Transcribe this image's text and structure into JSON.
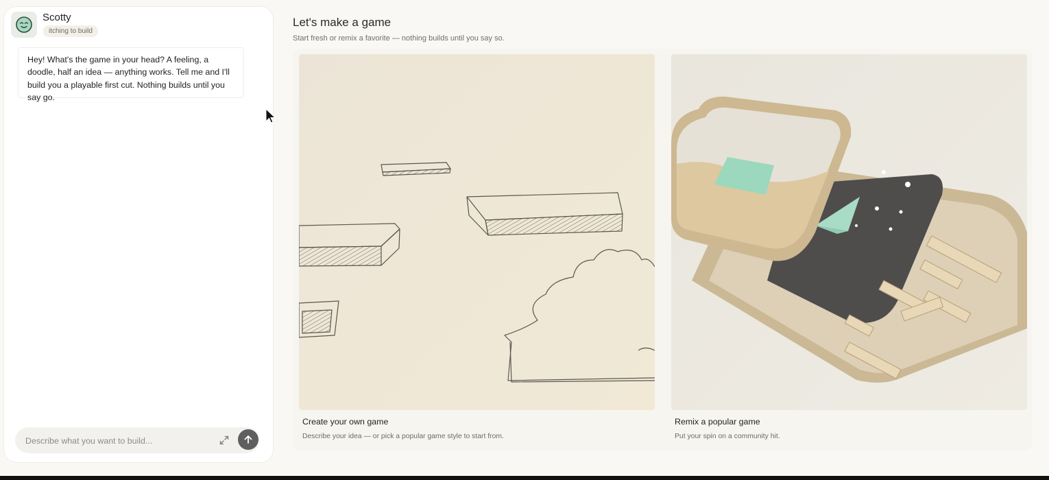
{
  "chat": {
    "agent_name": "Scotty",
    "status": "itching to build",
    "message": "Hey! What's the game in your head? A feeling, a doodle, half an idea — anything works. Tell me and I'll build you a playable first cut. Nothing builds until you say go.",
    "input_placeholder": "Describe what you want to build...",
    "icons": {
      "avatar": "smiling-face-icon",
      "expand": "expand-icon",
      "send": "arrow-up-icon"
    }
  },
  "main": {
    "title": "Let's make a game",
    "subtitle": "Start fresh or remix a favorite — nothing builds until you say so.",
    "cards": [
      {
        "title": "Create your own game",
        "description": "Describe your idea — or pick a popular game style to start from.",
        "image": "pencil-sketch-platforms"
      },
      {
        "title": "Remix a popular game",
        "description": "Put your spin on a community hit.",
        "image": "wooden-game-board-craft"
      }
    ]
  },
  "colors": {
    "background": "#faf8f4",
    "panel": "#ffffff",
    "send_button": "#5f5f5f",
    "accent_green": "#8fd3b6"
  }
}
